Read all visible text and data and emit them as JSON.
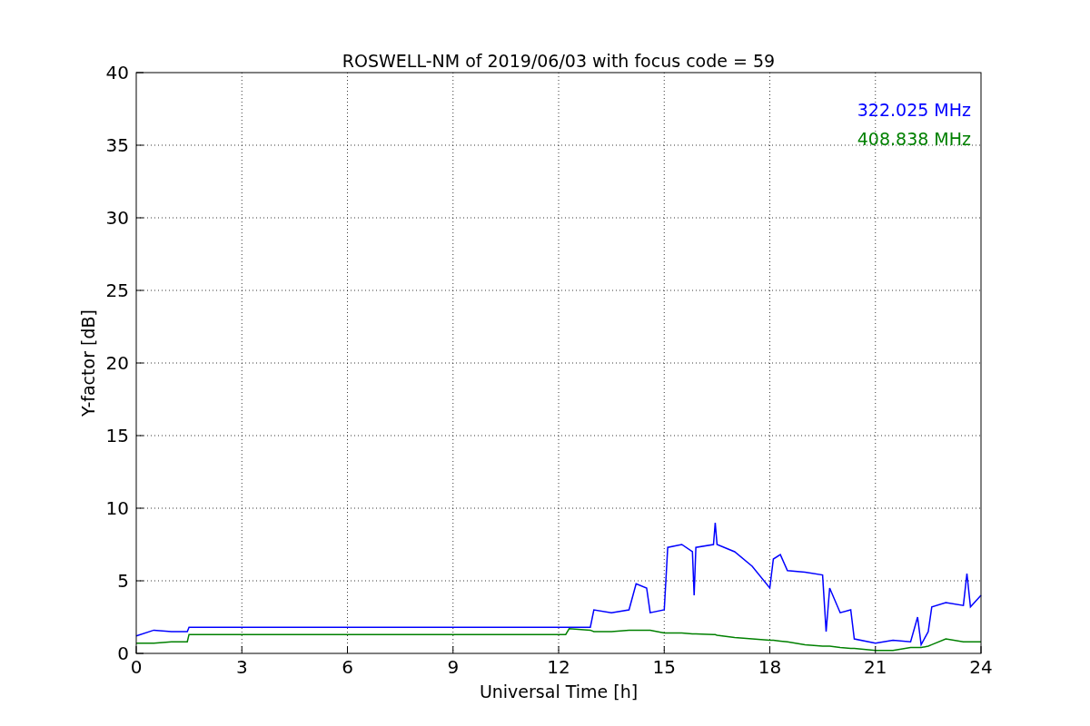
{
  "chart_data": {
    "type": "line",
    "title": "ROSWELL-NM of 2019/06/03 with focus code = 59",
    "xlabel": "Universal Time [h]",
    "ylabel": "Y-factor [dB]",
    "x": [
      0,
      0.5,
      1,
      1.45,
      1.5,
      12.2,
      12.3,
      12.9,
      13,
      13.5,
      14,
      14.2,
      14.5,
      14.6,
      15,
      15.1,
      15.5,
      15.8,
      15.85,
      15.9,
      16.4,
      16.45,
      16.5,
      17,
      17.5,
      18,
      18.1,
      18.3,
      18.5,
      19,
      19.5,
      19.6,
      19.7,
      20,
      20.3,
      20.4,
      21,
      21.5,
      22,
      22.2,
      22.3,
      22.5,
      22.6,
      23,
      23.5,
      23.6,
      23.7,
      24
    ],
    "series": [
      {
        "name": "322.025 MHz",
        "color": "#0000ff",
        "values": [
          1.2,
          1.6,
          1.5,
          1.5,
          1.8,
          1.8,
          1.8,
          1.8,
          3.0,
          2.8,
          3.0,
          4.8,
          4.5,
          2.8,
          3.0,
          7.3,
          7.5,
          7.0,
          4.0,
          7.3,
          7.5,
          9.0,
          7.5,
          7.0,
          6.0,
          4.5,
          6.5,
          6.8,
          5.7,
          5.6,
          5.4,
          1.5,
          4.5,
          2.8,
          3.0,
          1.0,
          0.7,
          0.9,
          0.8,
          2.5,
          0.6,
          1.5,
          3.2,
          3.5,
          3.3,
          5.5,
          3.2,
          4.0
        ]
      },
      {
        "name": "408.838 MHz",
        "color": "#008000",
        "values": [
          0.7,
          0.7,
          0.8,
          0.8,
          1.3,
          1.3,
          1.7,
          1.6,
          1.5,
          1.5,
          1.6,
          1.6,
          1.6,
          1.6,
          1.4,
          1.4,
          1.4,
          1.35,
          1.35,
          1.35,
          1.3,
          1.3,
          1.25,
          1.1,
          1.0,
          0.9,
          0.9,
          0.85,
          0.8,
          0.6,
          0.5,
          0.5,
          0.5,
          0.4,
          0.35,
          0.35,
          0.2,
          0.2,
          0.4,
          0.4,
          0.4,
          0.5,
          0.6,
          1.0,
          0.8,
          0.8,
          0.8,
          0.8
        ]
      }
    ],
    "xlim": [
      0,
      24
    ],
    "ylim": [
      0,
      40
    ],
    "xticks": [
      0,
      3,
      6,
      9,
      12,
      15,
      18,
      21,
      24
    ],
    "yticks": [
      0,
      5,
      10,
      15,
      20,
      25,
      30,
      35,
      40
    ],
    "grid": true
  }
}
